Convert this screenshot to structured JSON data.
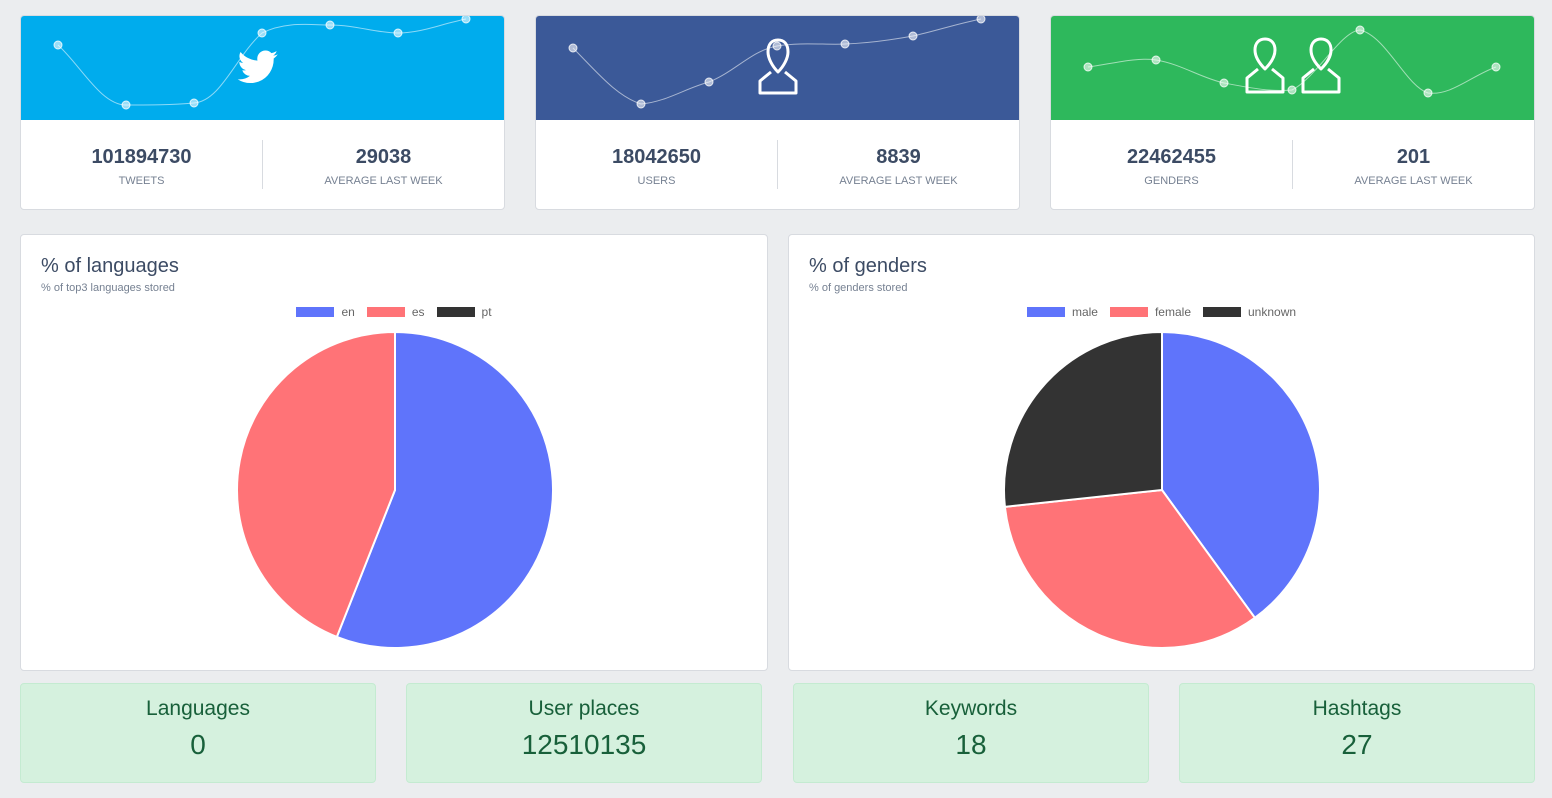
{
  "colors": {
    "twitter": "#00aced",
    "facebook": "#3b5998",
    "green": "#2eb85c",
    "blue_slice": "#5f74fb",
    "red_slice": "#ff7377",
    "dark_slice": "#333333"
  },
  "stat_cards": [
    {
      "icon": "twitter-icon",
      "value1": "101894730",
      "label1": "TWEETS",
      "value2": "29038",
      "label2": "AVERAGE LAST WEEK"
    },
    {
      "icon": "user-icon",
      "value1": "18042650",
      "label1": "USERS",
      "value2": "8839",
      "label2": "AVERAGE LAST WEEK"
    },
    {
      "icon": "users-icon",
      "value1": "22462455",
      "label1": "GENDERS",
      "value2": "201",
      "label2": "AVERAGE LAST WEEK"
    }
  ],
  "languages_chart": {
    "title": "% of languages",
    "subtitle": "% of top3 languages stored"
  },
  "genders_chart": {
    "title": "% of genders",
    "subtitle": "% of genders stored"
  },
  "chart_data": [
    {
      "type": "pie",
      "title": "% of languages",
      "categories": [
        "en",
        "es",
        "pt"
      ],
      "values": [
        56.0,
        44.0,
        0.0
      ],
      "colors": [
        "#5f74fb",
        "#ff7377",
        "#333333"
      ],
      "legend": "top"
    },
    {
      "type": "pie",
      "title": "% of genders",
      "categories": [
        "male",
        "female",
        "unknown"
      ],
      "values": [
        40.0,
        33.3,
        26.7
      ],
      "colors": [
        "#5f74fb",
        "#ff7377",
        "#333333"
      ],
      "legend": "top"
    }
  ],
  "mini_cards": [
    {
      "title": "Languages",
      "value": "0"
    },
    {
      "title": "User places",
      "value": "12510135"
    },
    {
      "title": "Keywords",
      "value": "18"
    },
    {
      "title": "Hashtags",
      "value": "27"
    }
  ]
}
